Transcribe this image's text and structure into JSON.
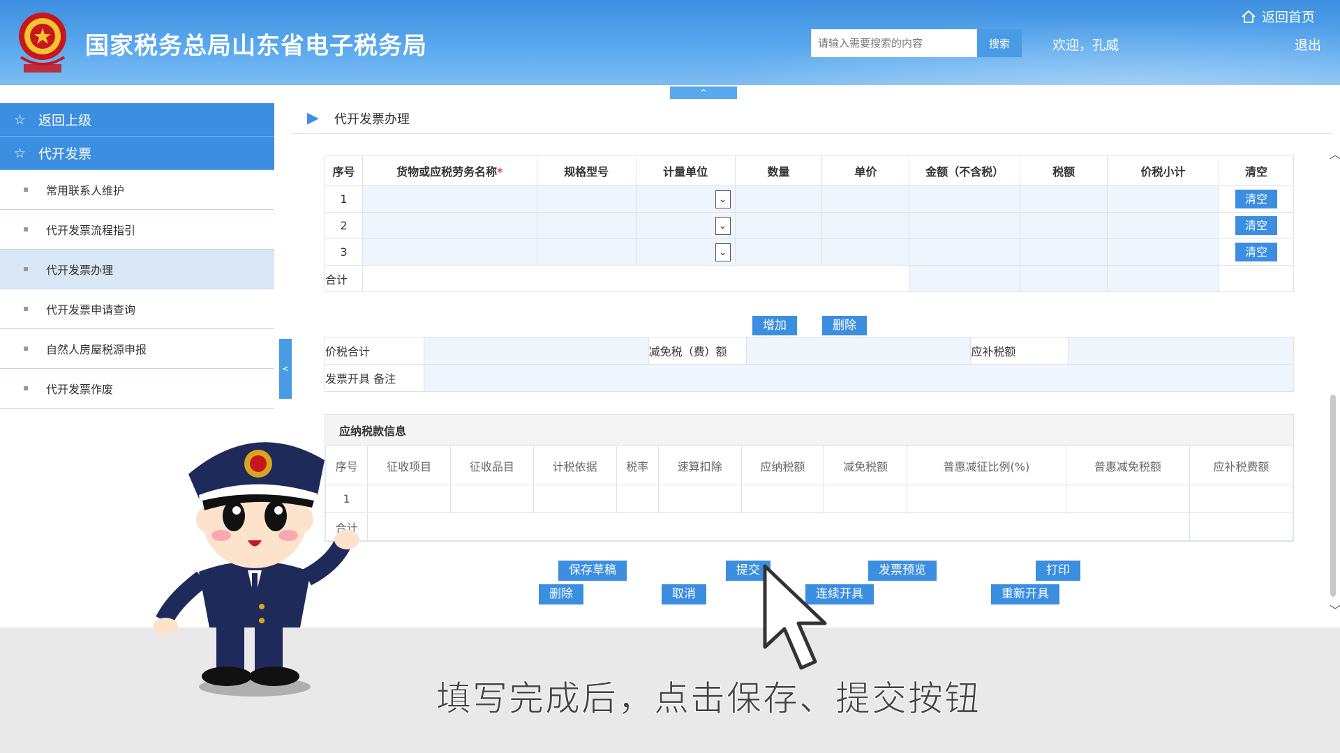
{
  "header": {
    "site_title": "国家税务总局山东省电子税务局",
    "search_placeholder": "请输入需要搜索的内容",
    "search_button": "搜索",
    "welcome": "欢迎，孔威",
    "home_link": "返回首页",
    "logout": "退出",
    "collapse": "^"
  },
  "sidebar": {
    "back": "返回上级",
    "section": "代开发票",
    "items": [
      {
        "label": "常用联系人维护"
      },
      {
        "label": "代开发票流程指引"
      },
      {
        "label": "代开发票办理"
      },
      {
        "label": "代开发票申请查询"
      },
      {
        "label": "自然人房屋税源申报"
      },
      {
        "label": "代开发票作废"
      }
    ],
    "toggle": "<"
  },
  "main": {
    "title": "代开发票办理",
    "goods_table": {
      "headers": [
        "序号",
        "货物或应税劳务名称",
        "规格型号",
        "计量单位",
        "数量",
        "单价",
        "金额（不含税）",
        "税额",
        "价税小计",
        "清空"
      ],
      "required_mark": "*",
      "rows": [
        "1",
        "2",
        "3"
      ],
      "clear_label": "清空",
      "total_label": "合计"
    },
    "add_button": "增加",
    "delete_row_button": "删除",
    "summary": {
      "price_tax_total": "价税合计",
      "exempt_tax": "减免税（费）额",
      "supplement_tax": "应补税额",
      "remark": "发票开具 备注"
    },
    "tax_info": {
      "title": "应纳税款信息",
      "headers": [
        "序号",
        "征收项目",
        "征收品目",
        "计税依据",
        "税率",
        "速算扣除",
        "应纳税额",
        "减免税额",
        "普惠减征比例(%)",
        "普惠减免税额",
        "应补税费额"
      ],
      "row_index": "1",
      "total_label": "合计"
    },
    "actions": {
      "save_draft": "保存草稿",
      "submit": "提交",
      "preview": "发票预览",
      "print": "打印",
      "delete": "删除",
      "cancel": "取消",
      "continuous": "连续开具",
      "reissue": "重新开具"
    }
  },
  "subtitle": "填写完成后，点击保存、提交按钮",
  "colors": {
    "primary": "#3b8ee0",
    "header": "#5aa8ee",
    "cell_fill": "#eef5fd",
    "logo_red": "#c8161d"
  }
}
